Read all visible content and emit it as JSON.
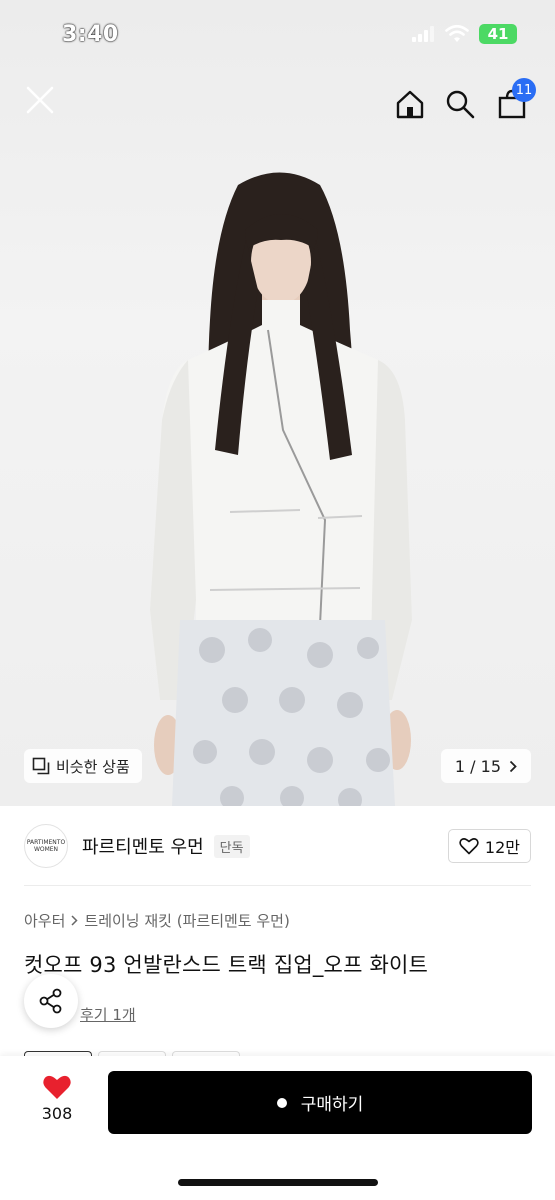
{
  "status_bar": {
    "time": "3:40",
    "battery": "41"
  },
  "nav": {
    "cart_count": "11"
  },
  "hero": {
    "similar_label": "비슷한 상품",
    "page_indicator": "1 / 15"
  },
  "brand": {
    "logo_line1": "PARTIMENTO",
    "logo_line2": "WOMEN",
    "name": "파르티멘토 우먼",
    "badge": "단독",
    "like_count": "12만"
  },
  "breadcrumb": {
    "category": "아우터",
    "subcategory": "트레이닝 재킷 (파르티멘토 우먼)"
  },
  "product": {
    "title": "컷오프 93 언발란스드 트랙 집업_오프 화이트",
    "review_text": "후기 1개"
  },
  "bottom": {
    "wish_count": "308",
    "buy_label": "구매하기"
  },
  "colors": {
    "accent_blue": "#2a6df4",
    "heart_red": "#e8212e",
    "buy_black": "#000000",
    "battery_green": "#4cd964"
  }
}
